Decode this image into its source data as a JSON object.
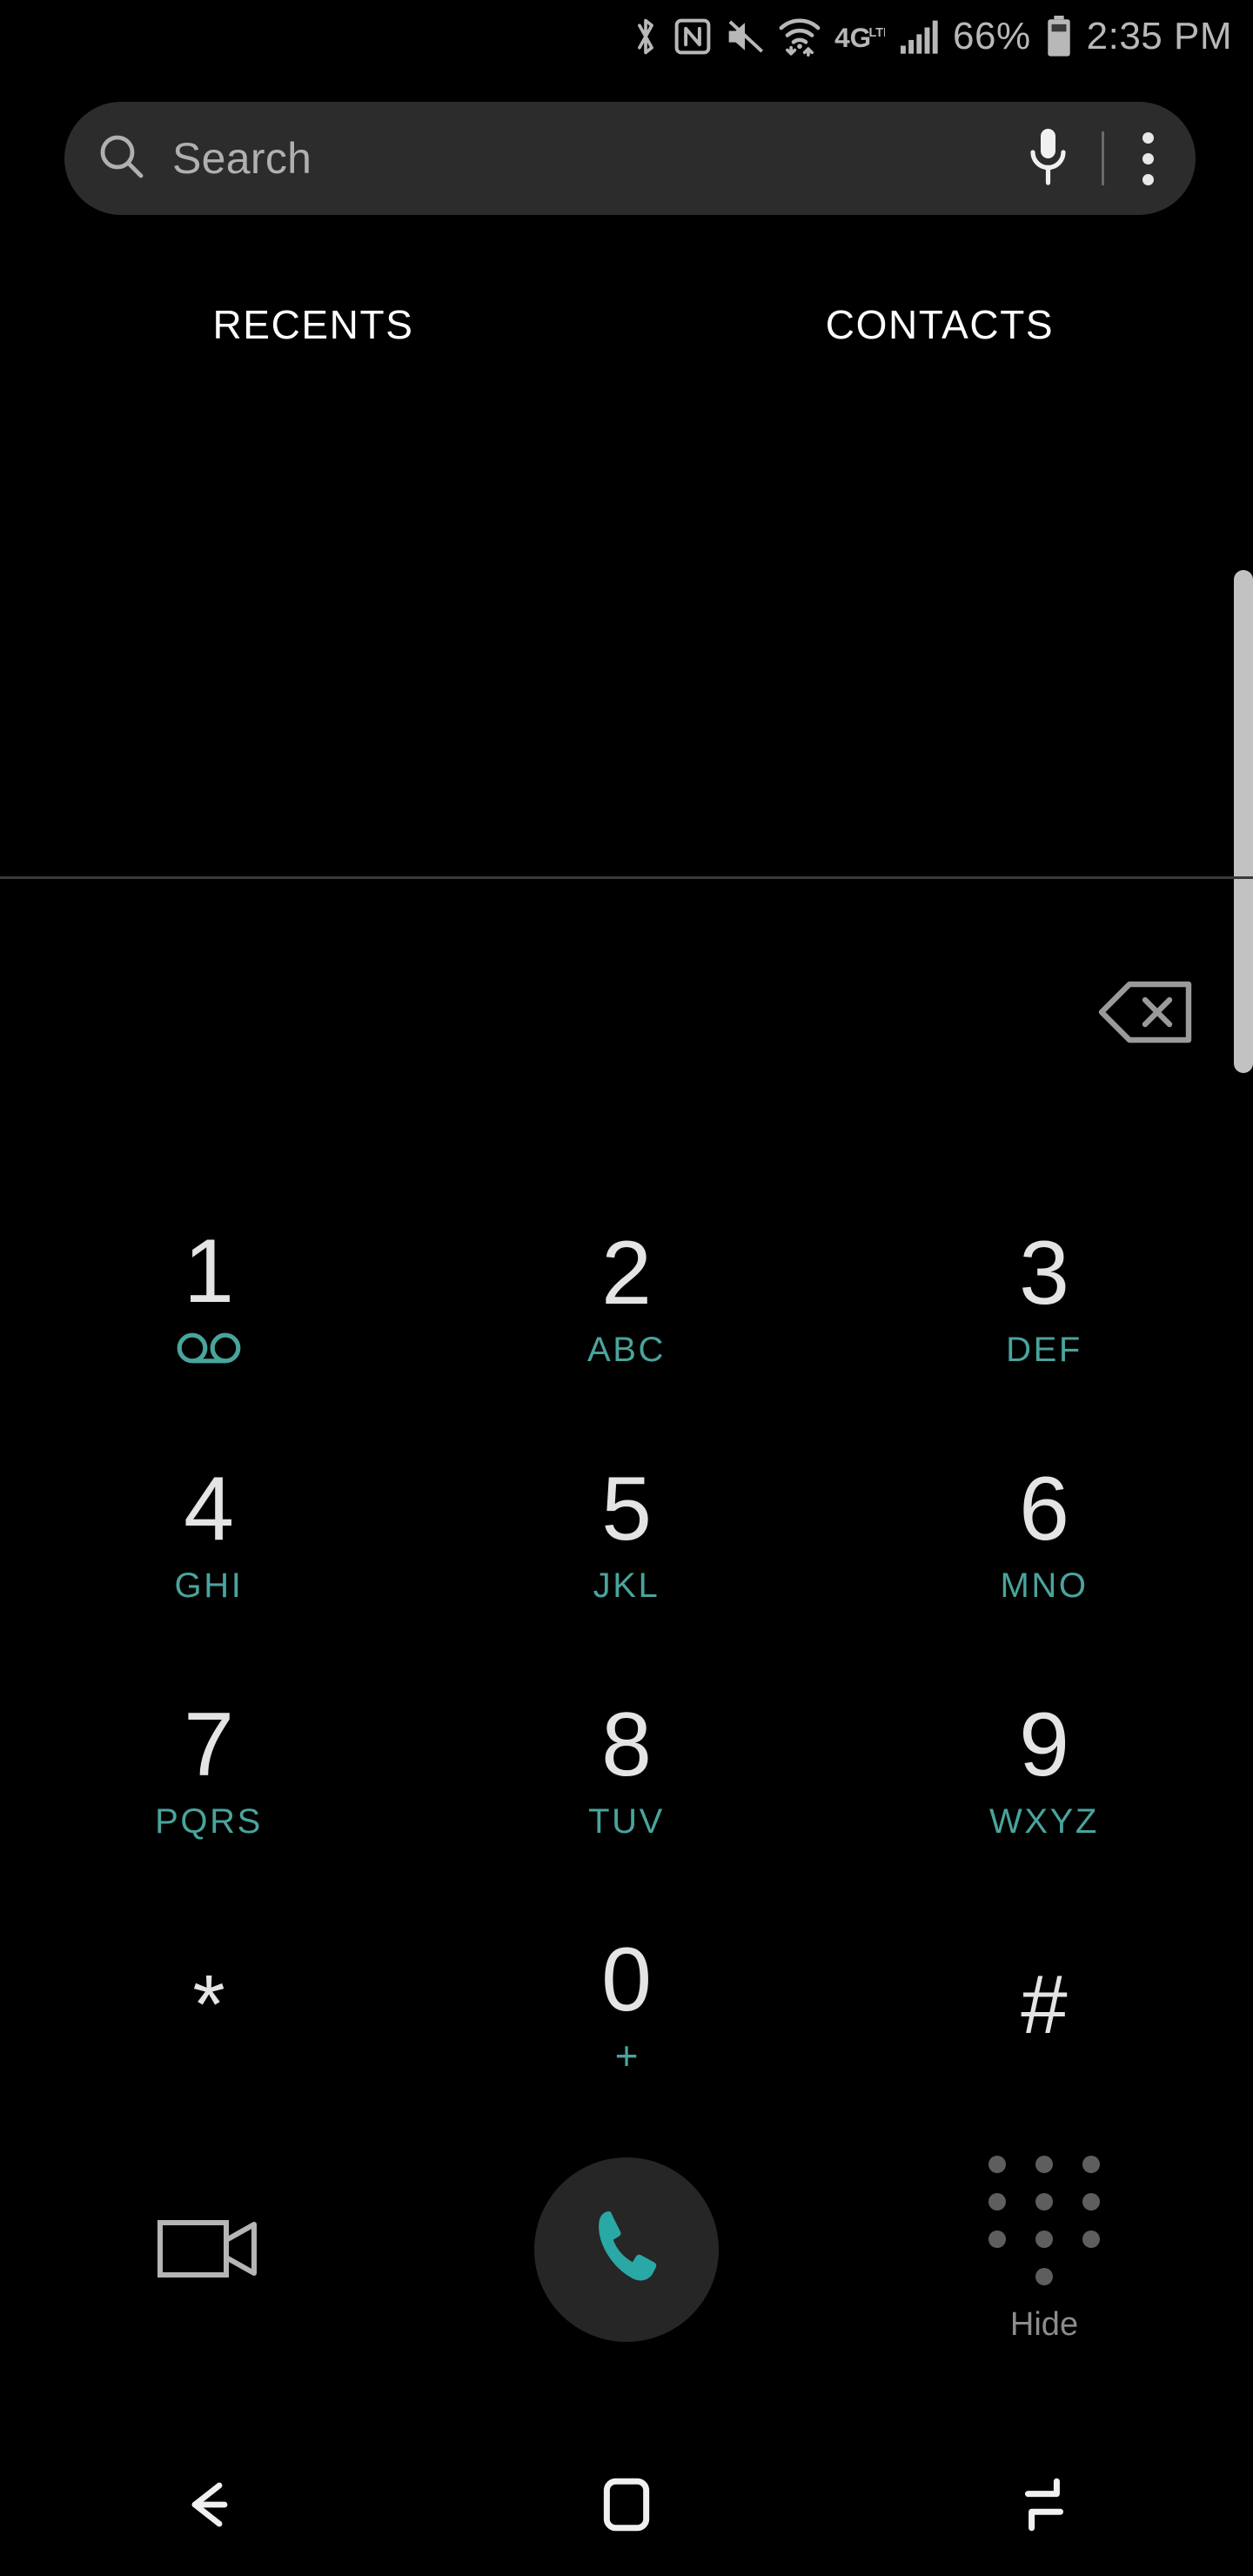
{
  "status_bar": {
    "icons": [
      "bluetooth-icon",
      "nfc-icon",
      "mute-icon",
      "wifi-icon",
      "network-4glte-icon",
      "signal-bars-icon",
      "battery-icon"
    ],
    "battery_percent": "66%",
    "time": "2:35 PM",
    "network_label": "4G",
    "network_sub": "LTE"
  },
  "search": {
    "placeholder": "Search",
    "search_icon": "search-icon",
    "mic_icon": "microphone-icon",
    "overflow_icon": "overflow-menu-icon"
  },
  "tabs": [
    {
      "label": "RECENTS",
      "name": "tab-recents"
    },
    {
      "label": "CONTACTS",
      "name": "tab-contacts"
    }
  ],
  "number_display": {
    "value": ""
  },
  "backspace": {
    "icon": "backspace-icon"
  },
  "dialpad": {
    "keys": [
      {
        "digit": "1",
        "sub": "",
        "icon": "voicemail-icon"
      },
      {
        "digit": "2",
        "sub": "ABC",
        "icon": ""
      },
      {
        "digit": "3",
        "sub": "DEF",
        "icon": ""
      },
      {
        "digit": "4",
        "sub": "GHI",
        "icon": ""
      },
      {
        "digit": "5",
        "sub": "JKL",
        "icon": ""
      },
      {
        "digit": "6",
        "sub": "MNO",
        "icon": ""
      },
      {
        "digit": "7",
        "sub": "PQRS",
        "icon": ""
      },
      {
        "digit": "8",
        "sub": "TUV",
        "icon": ""
      },
      {
        "digit": "9",
        "sub": "WXYZ",
        "icon": ""
      },
      {
        "digit": "*",
        "sub": "",
        "icon": ""
      },
      {
        "digit": "0",
        "sub": "+",
        "icon": ""
      },
      {
        "digit": "#",
        "sub": "",
        "icon": ""
      }
    ]
  },
  "actions": {
    "video_call": {
      "label": "",
      "icon": "video-camera-icon"
    },
    "call": {
      "label": "",
      "icon": "phone-handset-icon"
    },
    "hide_keypad": {
      "label": "Hide",
      "icon": "keypad-dots-icon"
    }
  },
  "nav_bar": {
    "back": "back-arrow-icon",
    "home": "home-square-icon",
    "recents": "recents-icon"
  },
  "colors": {
    "background": "#000000",
    "accent_teal": "#49a49c",
    "call_teal": "#2aa8a5",
    "search_bg": "#2c2c2c",
    "digit": "#e4e4e4",
    "muted": "#8c8c8c"
  }
}
